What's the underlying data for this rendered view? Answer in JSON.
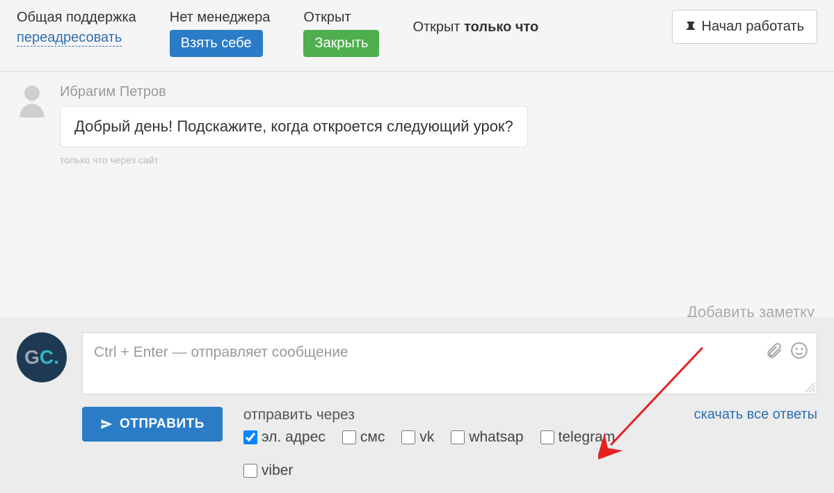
{
  "header": {
    "support_label": "Общая поддержка",
    "redirect_link": "переадресовать",
    "no_manager_label": "Нет менеджера",
    "take_btn": "Взять себе",
    "open_label": "Открыт",
    "close_btn": "Закрыть",
    "status_prefix": "Открыт ",
    "status_bold": "только что",
    "work_btn": "Начал работать"
  },
  "message": {
    "author": "Ибрагим Петров",
    "text": "Добрый день! Подскажите, когда откроется следующий урок?",
    "meta": "только что через сайт"
  },
  "add_note": "Добавить заметку",
  "compose": {
    "placeholder": "Ctrl + Enter — отправляет сообщение",
    "send_btn": "ОТПРАВИТЬ",
    "send_via_label": "отправить через",
    "download_link": "скачать все ответы",
    "channels": [
      {
        "key": "email",
        "label": "эл. адрес",
        "checked": true
      },
      {
        "key": "sms",
        "label": "смс",
        "checked": false
      },
      {
        "key": "vk",
        "label": "vk",
        "checked": false
      },
      {
        "key": "whatsapp",
        "label": "whatsap",
        "checked": false
      },
      {
        "key": "telegram",
        "label": "telegram",
        "checked": false
      },
      {
        "key": "viber",
        "label": "viber",
        "checked": false
      }
    ]
  }
}
